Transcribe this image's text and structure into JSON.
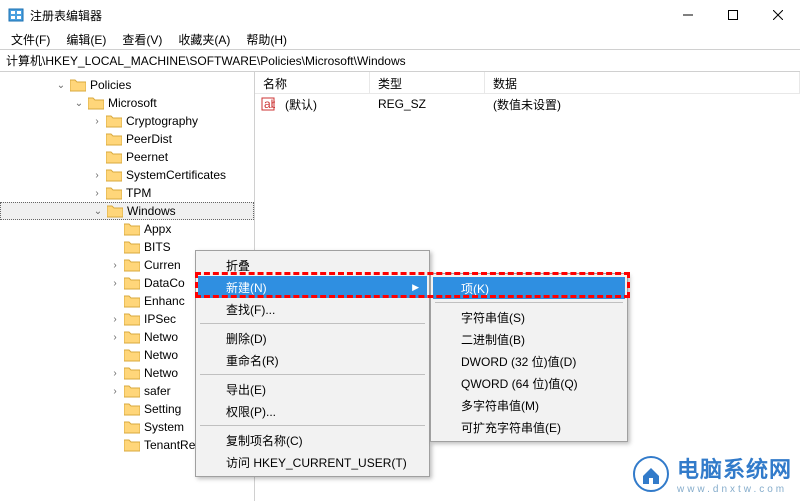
{
  "window": {
    "title": "注册表编辑器"
  },
  "winbuttons": {
    "min": "min",
    "max": "max",
    "close": "close"
  },
  "menus": [
    "文件(F)",
    "编辑(E)",
    "查看(V)",
    "收藏夹(A)",
    "帮助(H)"
  ],
  "address": "计算机\\HKEY_LOCAL_MACHINE\\SOFTWARE\\Policies\\Microsoft\\Windows",
  "columns": {
    "name": "名称",
    "type": "类型",
    "data": "数据"
  },
  "row1": {
    "name": "(默认)",
    "type": "REG_SZ",
    "data": "(数值未设置)"
  },
  "tree": {
    "policies": "Policies",
    "microsoft": "Microsoft",
    "crypto": "Cryptography",
    "peerdist": "PeerDist",
    "peernet": "Peernet",
    "syscert": "SystemCertificates",
    "tpm": "TPM",
    "windows": "Windows",
    "appx": "Appx",
    "bits": "BITS",
    "curren": "Curren",
    "dataco": "DataCo",
    "enhanc": "Enhanc",
    "ipsec": "IPSec",
    "netwo1": "Netwo",
    "netwo2": "Netwo",
    "netwo3": "Netwo",
    "safer": "safer",
    "setting": "Setting",
    "system": "System",
    "tenant": "TenantRestriction"
  },
  "ctx1": {
    "collapse": "折叠",
    "new": "新建(N)",
    "find": "查找(F)...",
    "delete": "删除(D)",
    "rename": "重命名(R)",
    "export": "导出(E)",
    "perm": "权限(P)...",
    "copy": "复制项名称(C)",
    "goto": "访问 HKEY_CURRENT_USER(T)"
  },
  "ctx2": {
    "key": "项(K)",
    "string": "字符串值(S)",
    "binary": "二进制值(B)",
    "dword": "DWORD (32 位)值(D)",
    "qword": "QWORD (64 位)值(Q)",
    "multi": "多字符串值(M)",
    "expand": "可扩充字符串值(E)"
  },
  "watermark": {
    "text": "电脑系统网",
    "sub": "www.dnxtw.com"
  }
}
